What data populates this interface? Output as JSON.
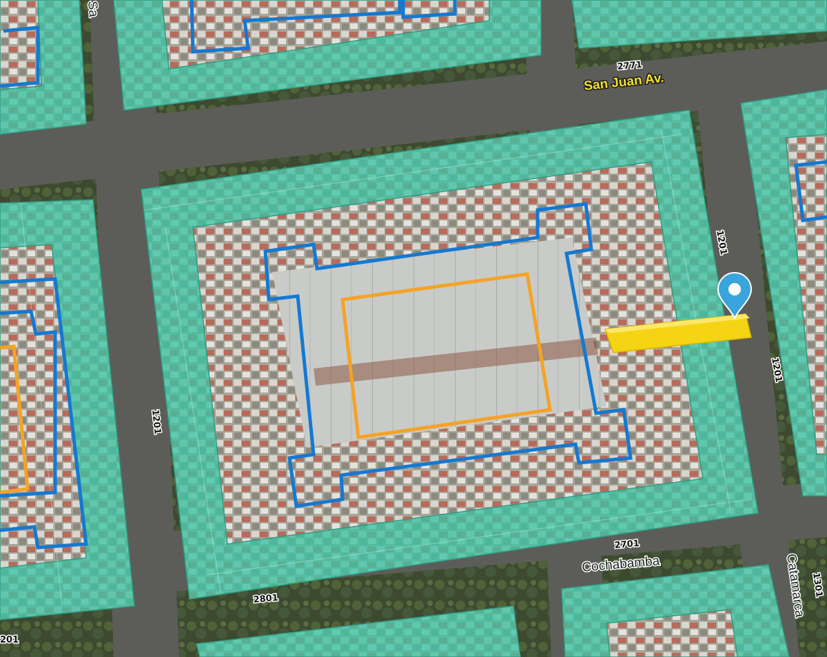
{
  "map": {
    "streets": {
      "san_juan": "San Juan Av.",
      "cochabamba": "Cochabamba",
      "catamarca": "Catamarca",
      "partial_top_left": "Sa"
    },
    "address_numbers": {
      "n2771": "2771",
      "n1201_right": "1201",
      "n1201_far_right": "1201",
      "n1201_left": "1201",
      "n2701": "2701",
      "n2801": "2801",
      "n1301": "1301",
      "n201_bottom_left": "201"
    },
    "colors": {
      "buffer_fill": "#3dc3a3",
      "parcel_outline": "#1479d1",
      "highlight_outline": "#f4a326",
      "selected_parcel": "#f5d414",
      "marker": "#3aa5dc"
    },
    "marker_icon": "map-pin-icon"
  }
}
